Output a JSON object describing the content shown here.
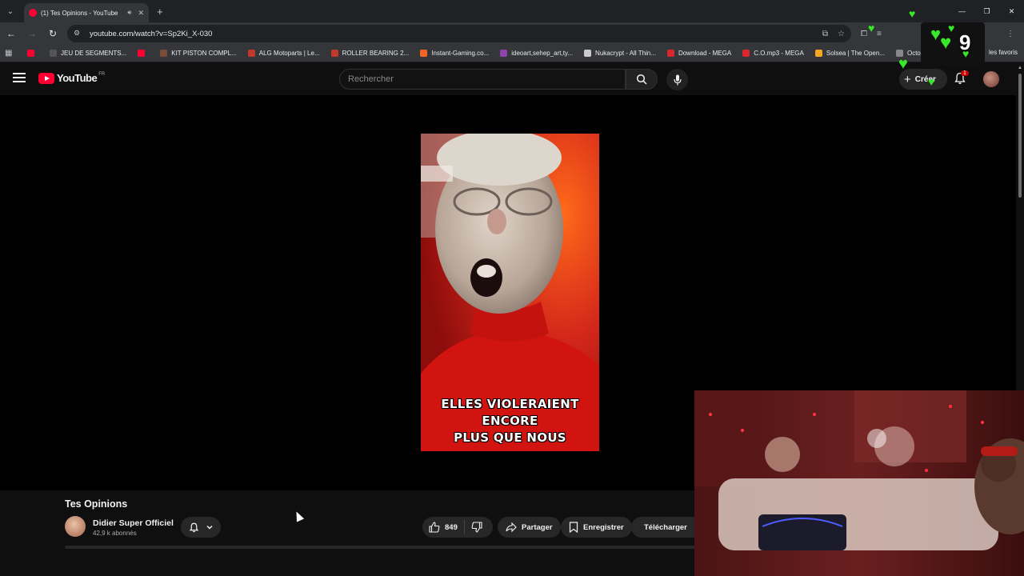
{
  "browser": {
    "tab_title": "(1) Tes Opinions - YouTube",
    "url": "youtube.com/watch?v=Sp2Ki_X-030",
    "bookmarks": [
      {
        "label": "",
        "color": "#ff0033"
      },
      {
        "label": "JEU DE SEGMENTS...",
        "color": "#555555"
      },
      {
        "label": "",
        "color": "#ff0033"
      },
      {
        "label": "KIT PISTON COMPL...",
        "color": "#7a4b3a"
      },
      {
        "label": "ALG Motoparts | Le...",
        "color": "#c0392b"
      },
      {
        "label": "ROLLER BEARING 2...",
        "color": "#c0392b"
      },
      {
        "label": "Instant-Gaming.co...",
        "color": "#f26522"
      },
      {
        "label": "ideoart,sehep_art,ty...",
        "color": "#8e44ad"
      },
      {
        "label": "Nukacrypt - All Thin...",
        "color": "#cccccc"
      },
      {
        "label": "Download - MEGA",
        "color": "#d9272e"
      },
      {
        "label": "C.O.mp3 - MEGA",
        "color": "#d9272e"
      },
      {
        "label": "Solsea | The Open...",
        "color": "#f5a623"
      },
      {
        "label": "OctoSol | Solsea",
        "color": "#888888"
      }
    ],
    "bookmarks_right": "les favoris"
  },
  "youtube": {
    "logo_text": "YouTube",
    "logo_region": "FR",
    "search_placeholder": "Rechercher",
    "create_label": "Créer",
    "notification_count": "1"
  },
  "video": {
    "caption_line1": "ELLES VIOLERAIENT ENCORE",
    "caption_line2": "PLUS QUE NOUS",
    "title": "Tes Opinions",
    "channel_name": "Didier Super Officiel",
    "subscribers": "42,9 k abonnés",
    "likes": "849",
    "share_label": "Partager",
    "save_label": "Enregistrer",
    "download_label": "Télécharger"
  },
  "overlay": {
    "counter": "9"
  },
  "colors": {
    "yt_red": "#ff0033",
    "bg": "#0f0f0f",
    "heart_green": "#38e82a"
  }
}
